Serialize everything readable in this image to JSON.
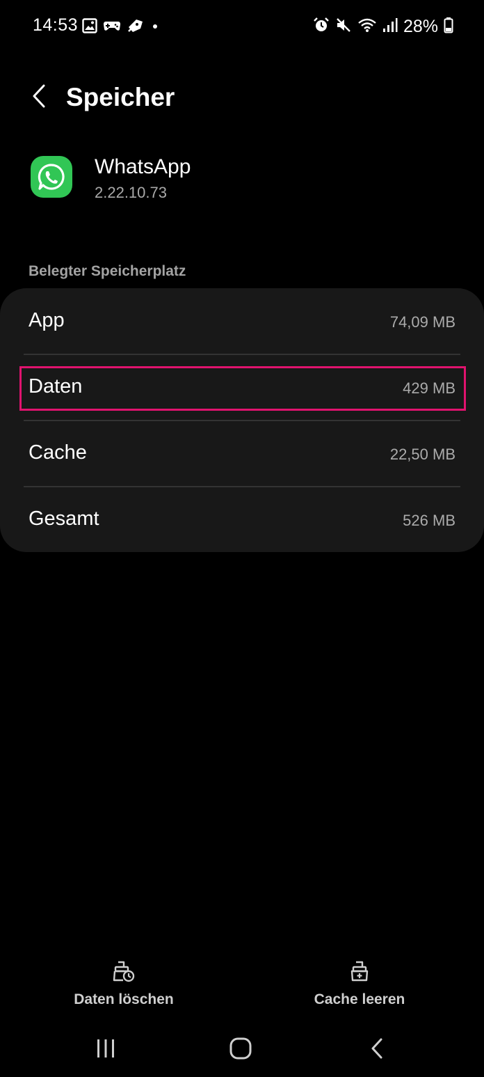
{
  "status_bar": {
    "time": "14:53",
    "battery_text": "28%",
    "left_icons": [
      "gallery-icon",
      "game-controller-icon",
      "game-tools-icon",
      "dot-icon"
    ],
    "right_icons": [
      "alarm-icon",
      "mute-icon",
      "wifi-icon",
      "signal-icon",
      "battery-icon"
    ]
  },
  "header": {
    "title": "Speicher",
    "back_icon": "chevron-left-icon"
  },
  "app": {
    "name": "WhatsApp",
    "version": "2.22.10.73",
    "icon": "whatsapp-icon",
    "icon_color": "#31c655"
  },
  "storage": {
    "section_label": "Belegter Speicherplatz",
    "rows": [
      {
        "label": "App",
        "value": "74,09 MB"
      },
      {
        "label": "Daten",
        "value": "429 MB"
      },
      {
        "label": "Cache",
        "value": "22,50 MB"
      },
      {
        "label": "Gesamt",
        "value": "526 MB"
      }
    ],
    "highlight_color": "#e0136e"
  },
  "actions": {
    "clear_data_label": "Daten löschen",
    "clear_cache_label": "Cache leeren"
  },
  "nav": {
    "recents_icon": "recents-icon",
    "home_icon": "home-icon",
    "back_icon": "back-icon"
  }
}
